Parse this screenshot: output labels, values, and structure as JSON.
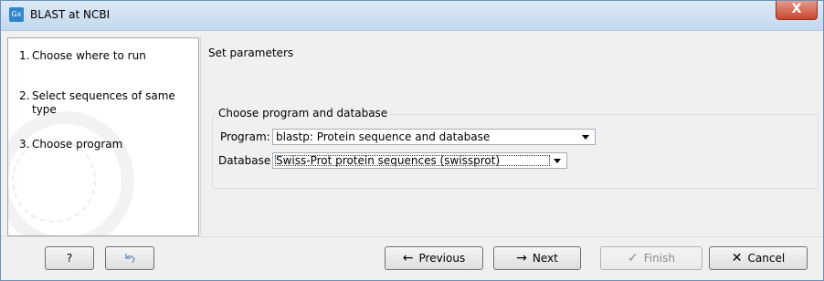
{
  "window": {
    "title": "BLAST at NCBI",
    "app_icon_text": "Gx",
    "close_label": "X"
  },
  "steps": [
    {
      "number": "1.",
      "label": "Choose where to run"
    },
    {
      "number": "2.",
      "label": "Select sequences of same type"
    },
    {
      "number": "3.",
      "label": "Choose program"
    }
  ],
  "main": {
    "heading": "Set parameters",
    "group_title": "Choose program and database",
    "program": {
      "label": "Program:",
      "value": "blastp: Protein sequence and database"
    },
    "database": {
      "label": "Database",
      "value": "Swiss-Prot protein sequences (swissprot)"
    }
  },
  "buttons": {
    "help": "?",
    "reset_icon": "undo-icon",
    "previous": "Previous",
    "next": "Next",
    "finish": "Finish",
    "cancel": "Cancel"
  },
  "icons": {
    "previous": "←",
    "next": "→",
    "finish": "✓",
    "cancel": "✕"
  },
  "colors": {
    "title_bar": "#c4d8ee",
    "close_button": "#c9462e",
    "window_bg": "#f0f0f0"
  }
}
